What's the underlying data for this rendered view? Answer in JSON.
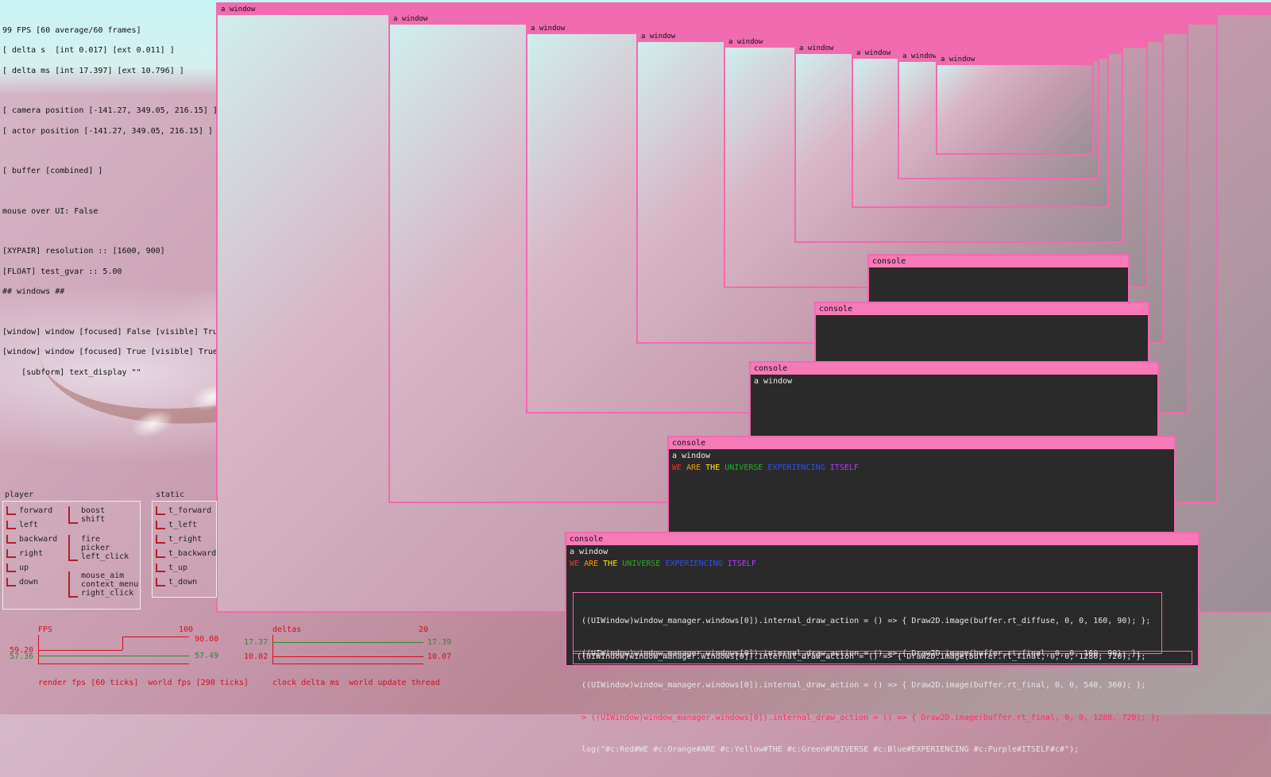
{
  "stats": {
    "fps": "99 FPS [60 average/60 frames]",
    "delta_s": "[ delta s  [int 0.017] [ext 0.011] ]",
    "delta_ms": "[ delta ms [int 17.397] [ext 10.796] ]",
    "camera_position": "[ camera position [-141.27, 349.05, 216.15] ]",
    "actor_position": "[ actor position [-141.27, 349.05, 216.15] ]",
    "buffer": "[ buffer [combined] ]",
    "mouse_over_ui": "mouse over UI: False",
    "resolution": "[XYPAIR] resolution :: [1600, 900]",
    "test_gvar": "[FLOAT] test_gvar :: 5.00",
    "windows_header": "## windows ##",
    "window1": "[window] window [focused] False [visible] True",
    "window2": "[window] window [focused] True [visible] True",
    "subform": "    [subform] text_display \"\""
  },
  "player_panel": {
    "title": "player",
    "left_keys": [
      "forward",
      "left",
      "backward",
      "right",
      "up",
      "down"
    ],
    "right_keys": [
      "boost\nshift",
      "fire\npicker\nleft_click",
      "mouse_aim\ncontext_menu\nright_click"
    ]
  },
  "static_panel": {
    "title": "static",
    "keys": [
      "t_forward",
      "t_left",
      "t_right",
      "t_backward",
      "t_up",
      "t_down"
    ]
  },
  "fps_graph": {
    "label": "FPS",
    "max": "100",
    "left_red": "59.20",
    "left_green": "57.36",
    "right_red": "90.00",
    "right_green": "57.49",
    "legend": "render fps [60 ticks]  world fps [290 ticks]"
  },
  "deltas_graph": {
    "label": "deltas",
    "max": "20",
    "left_green": "17.37",
    "left_red": "10.02",
    "right_green": "17.39",
    "right_red": "10.07",
    "legend": "clock delta ms  world update thread"
  },
  "nested_window_title": "a window",
  "console": {
    "title": "console",
    "window_label": "a window",
    "colored_words": [
      {
        "text": "WE",
        "color": "#ff2a2a"
      },
      {
        "text": "ARE",
        "color": "#ff9a00"
      },
      {
        "text": "THE",
        "color": "#ffe600"
      },
      {
        "text": "UNIVERSE",
        "color": "#23b223"
      },
      {
        "text": "EXPERIENCING",
        "color": "#2f4dff"
      },
      {
        "text": "ITSELF",
        "color": "#b23bff"
      }
    ],
    "lines": [
      "((UIWindow)window_manager.windows[0]).internal_draw_action = () => { Draw2D.image(buffer.rt_diffuse, 0, 0, 160, 90); };",
      "((UIWindow)window_manager.windows[0]).internal_draw_action = () => { Draw2D.image(buffer.rt_final, 0, 0, 160, 90); };",
      "((UIWindow)window_manager.windows[0]).internal_draw_action = () => { Draw2D.image(buffer.rt_final, 0, 0, 540, 360); };",
      "> ((UIWindow)window_manager.windows[0]).internal_draw_action = () => { Draw2D.image(buffer.rt_final, 0, 0, 1280, 720); };",
      "log(\"#c:Red#WE #c:Orange#ARE #c:Yellow#THE #c:Green#UNIVERSE #c:Blue#EXPERIENCING #c:Purple#ITSELF#c#\");"
    ],
    "input": "((UIWindow)window_manager.windows[0]).internal_draw_action = () => { Draw2D.image(buffer.rt_final, 0, 0, 1280, 720); };"
  },
  "colors": {
    "window_border": "#f06bb0",
    "console_bar": "#f779b7",
    "graph_red": "#d01020",
    "graph_green": "#2f8a2f"
  }
}
